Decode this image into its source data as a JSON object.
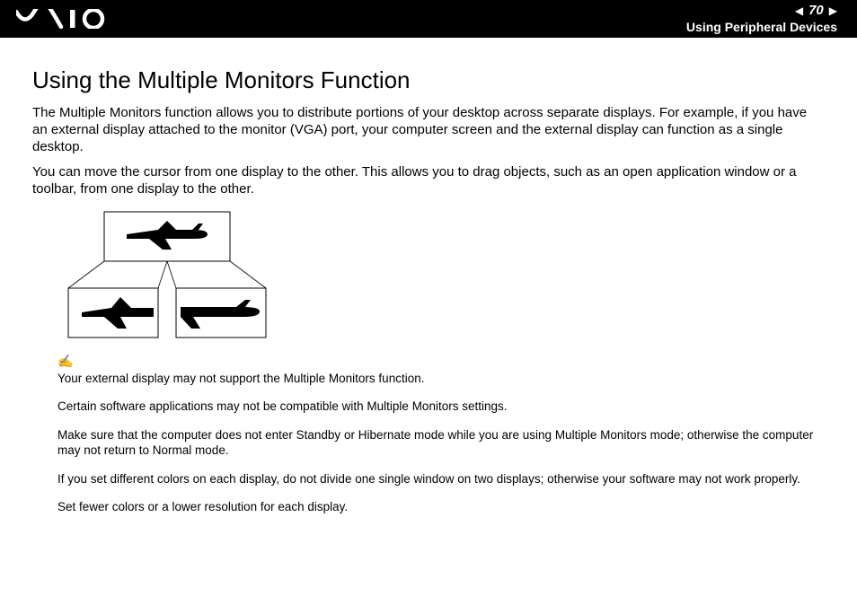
{
  "header": {
    "page_number": "70",
    "section_title": "Using Peripheral Devices"
  },
  "page": {
    "heading": "Using the Multiple Monitors Function",
    "paragraph1": "The Multiple Monitors function allows you to distribute portions of your desktop across separate displays. For example, if you have an external display attached to the monitor (VGA) port, your computer screen and the external display can function as a single desktop.",
    "paragraph2": "You can move the cursor from one display to the other. This allows you to drag objects, such as an open application window or a toolbar, from one display to the other.",
    "note1": "Your external display may not support the Multiple Monitors function.",
    "note2": "Certain software applications may not be compatible with Multiple Monitors settings.",
    "note3": "Make sure that the computer does not enter Standby or Hibernate mode while you are using Multiple Monitors mode; otherwise the computer may not return to Normal mode.",
    "note4": "If you set different colors on each display, do not divide one single window on two displays; otherwise your software may not work properly.",
    "note5": "Set fewer colors or a lower resolution for each display."
  }
}
